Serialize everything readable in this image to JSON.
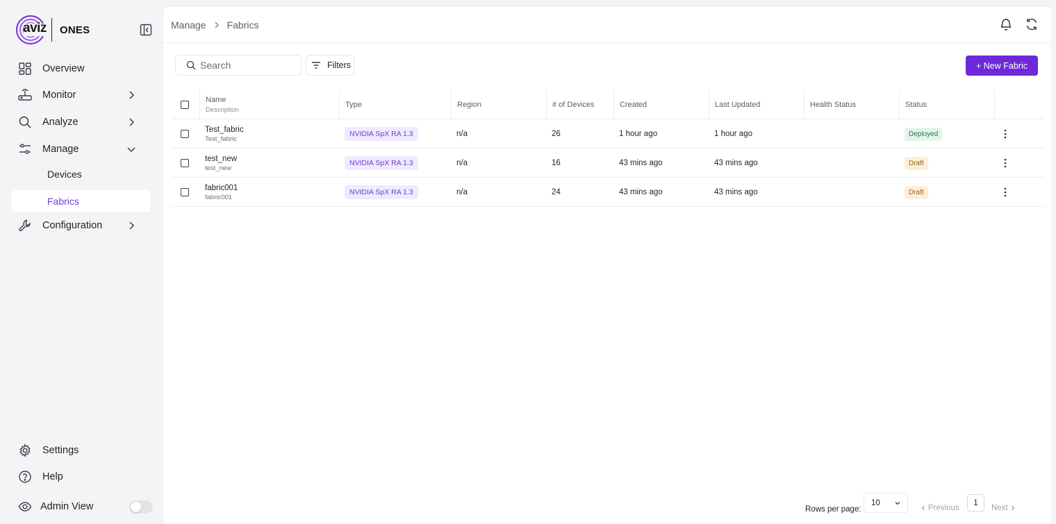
{
  "brand": {
    "logo_text": "aviz",
    "product": "ONES"
  },
  "sidebar": {
    "items": [
      {
        "label": "Overview",
        "icon": "grid-icon"
      },
      {
        "label": "Monitor",
        "icon": "router-icon"
      },
      {
        "label": "Analyze",
        "icon": "search-icon"
      },
      {
        "label": "Manage",
        "icon": "sliders-icon"
      },
      {
        "label": "Configuration",
        "icon": "wrench-icon"
      }
    ],
    "manage_sub": [
      {
        "label": "Devices"
      },
      {
        "label": "Fabrics"
      }
    ],
    "bottom": [
      {
        "label": "Settings",
        "icon": "gear-icon"
      },
      {
        "label": "Help",
        "icon": "help-circle-icon"
      },
      {
        "label": "Admin View",
        "icon": "eye-icon"
      }
    ]
  },
  "header": {
    "breadcrumb": [
      "Manage",
      "Fabrics"
    ]
  },
  "toolbar": {
    "search_placeholder": "Search",
    "filters_label": "Filters",
    "new_label": "+ New Fabric"
  },
  "table": {
    "columns": {
      "name": "Name",
      "description": "Description",
      "type": "Type",
      "region": "Region",
      "devices": "# of Devices",
      "created": "Created",
      "updated": "Last Updated",
      "health": "Health Status",
      "status": "Status"
    },
    "rows": [
      {
        "name": "Test_fabric",
        "description": "Test_fabric",
        "type": "NVIDIA SpX RA 1.3",
        "region": "n/a",
        "devices": "26",
        "created": "1 hour ago",
        "updated": "1 hour ago",
        "health": "",
        "status": "Deployed"
      },
      {
        "name": "test_new",
        "description": "test_new",
        "type": "NVIDIA SpX RA 1.3",
        "region": "n/a",
        "devices": "16",
        "created": "43 mins ago",
        "updated": "43 mins ago",
        "health": "",
        "status": "Draft"
      },
      {
        "name": "fabric001",
        "description": "fabric001",
        "type": "NVIDIA SpX RA 1.3",
        "region": "n/a",
        "devices": "24",
        "created": "43 mins ago",
        "updated": "43 mins ago",
        "health": "",
        "status": "Draft"
      }
    ]
  },
  "pagination": {
    "rows_per_page_label": "Rows per page:",
    "rows_per_page_value": "10",
    "previous": "Previous",
    "next": "Next",
    "current_page": "1"
  },
  "colors": {
    "accent": "#6d28d9",
    "active_nav_text": "#6b3fd4",
    "deployed_bg": "#e3f5ea",
    "draft_bg": "#fbefd9"
  }
}
